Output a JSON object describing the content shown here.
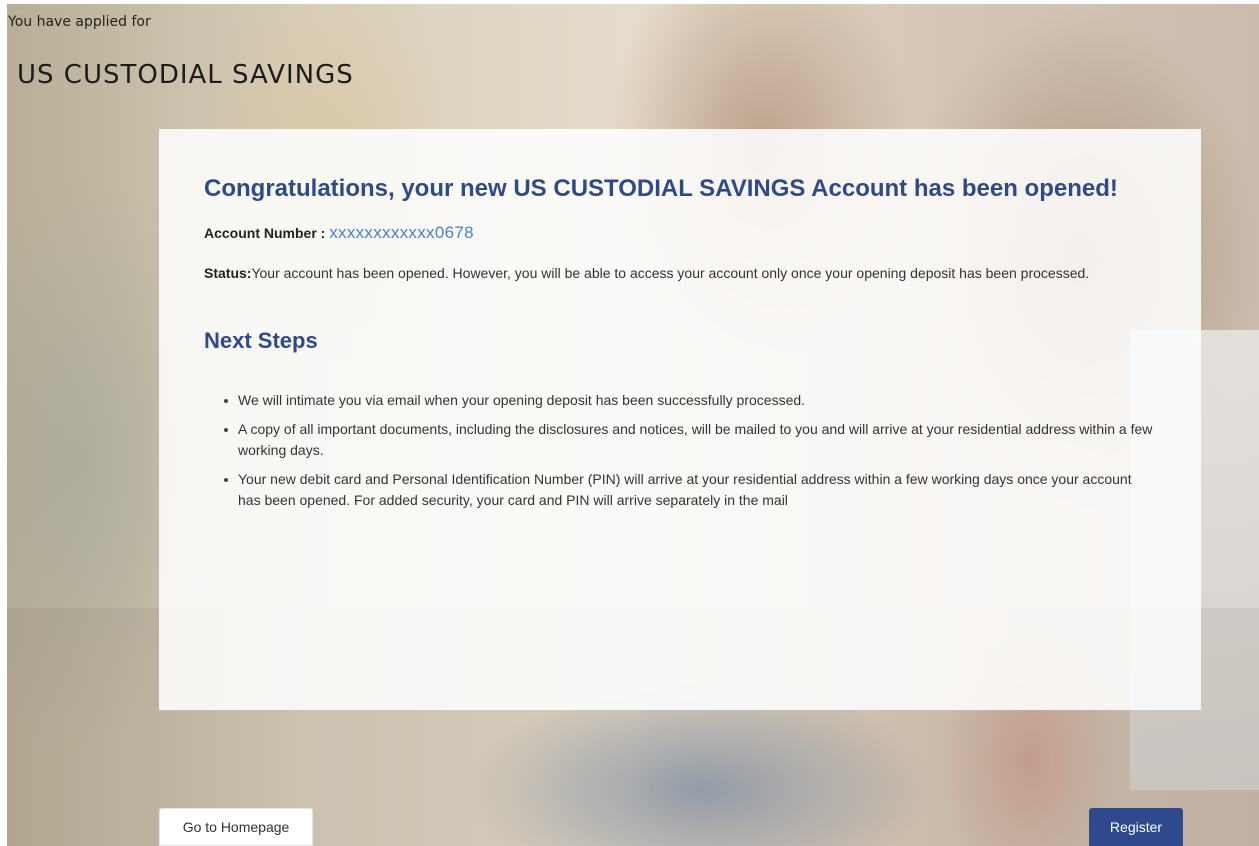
{
  "header": {
    "applied_text": "You have applied for",
    "product_name": "US CUSTODIAL SAVINGS"
  },
  "confirmation": {
    "title": "Congratulations, your new US CUSTODIAL SAVINGS Account has been opened!",
    "account_label": "Account Number : ",
    "account_number": "xxxxxxxxxxxx0678",
    "status_label": "Status:",
    "status_text": "Your account has been opened. However, you will be able to access your account only once your opening deposit has been processed.",
    "next_steps_title": "Next Steps",
    "next_steps": [
      "We will intimate you via email when your opening deposit has been successfully processed.",
      "A copy of all important documents, including the disclosures and notices, will be mailed to you and will arrive at your residential address within a few working days.",
      "Your new debit card and Personal Identification Number (PIN) will arrive at your residential address within a few working days once your account has been opened. For added security, your card and PIN will arrive separately in the mail"
    ]
  },
  "actions": {
    "home_label": "Go to Homepage",
    "register_label": "Register"
  },
  "colors": {
    "primary": "#2e4a8c",
    "account_number": "#4a82c8"
  }
}
